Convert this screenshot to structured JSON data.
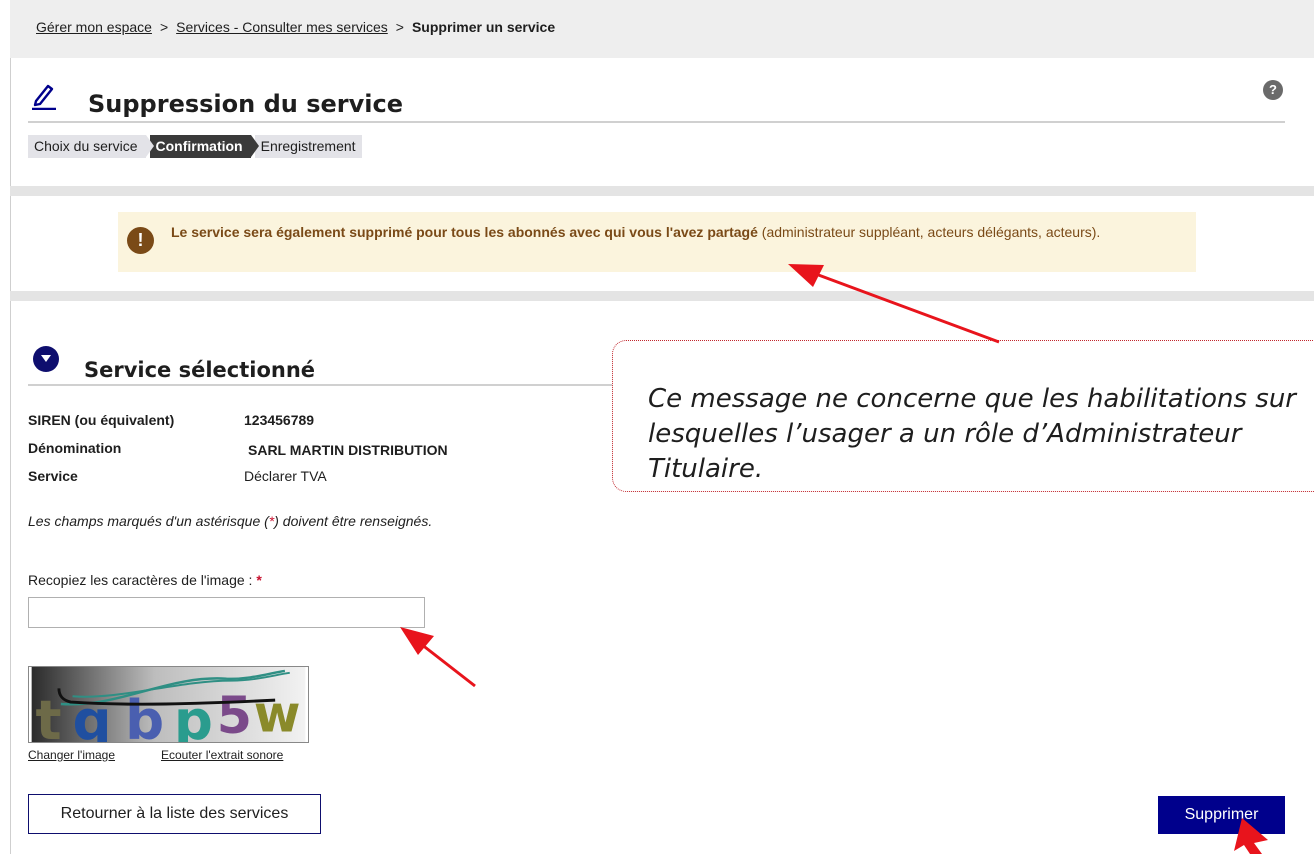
{
  "breadcrumb": {
    "item1": "Gérer mon espace",
    "sep1": ">",
    "item2": "Services - Consulter mes services",
    "sep2": ">",
    "current": "Supprimer un service"
  },
  "header": {
    "title": "Suppression du service",
    "help_glyph": "?",
    "icon": "pencil-icon"
  },
  "steps": [
    {
      "label": "Choix du service",
      "active": false
    },
    {
      "label": "Confirmation",
      "active": true
    },
    {
      "label": "Enregistrement",
      "active": false
    }
  ],
  "alert": {
    "glyph": "!",
    "bold_text": "Le service sera également supprimé pour tous les abonnés avec qui vous l'avez partagé",
    "normal_text": " (administrateur suppléant, acteurs délégants, acteurs)."
  },
  "section": {
    "title": "Service sélectionné"
  },
  "info": {
    "siren_label": "SIREN (ou équivalent)",
    "siren_value": "123456789",
    "denomination_label": "Dénomination",
    "denomination_value": "SARL MARTIN DISTRIBUTION",
    "service_label": "Service",
    "service_value": "Déclarer TVA"
  },
  "form": {
    "required_note_before": "Les champs marqués d'un astérisque (",
    "required_star": "*",
    "required_note_after": ") doivent être renseignés.",
    "captcha_label": "Recopiez les caractères de l'image :",
    "captcha_star": "*",
    "captcha_value": "",
    "captcha_text": "tqbp5w",
    "change_image": "Changer l'image",
    "listen_audio": "Ecouter l'extrait sonore"
  },
  "buttons": {
    "back": "Retourner à la liste des services",
    "delete": "Supprimer"
  },
  "callout": {
    "text": "Ce message ne concerne que les habilitations sur\nlesquelles l’usager a un rôle d’Administrateur\nTitulaire."
  },
  "colors": {
    "primary_blue": "#00008c",
    "alert_bg": "#fbf4dd",
    "alert_text": "#7a4a17",
    "annotation_red": "#e8141c"
  }
}
